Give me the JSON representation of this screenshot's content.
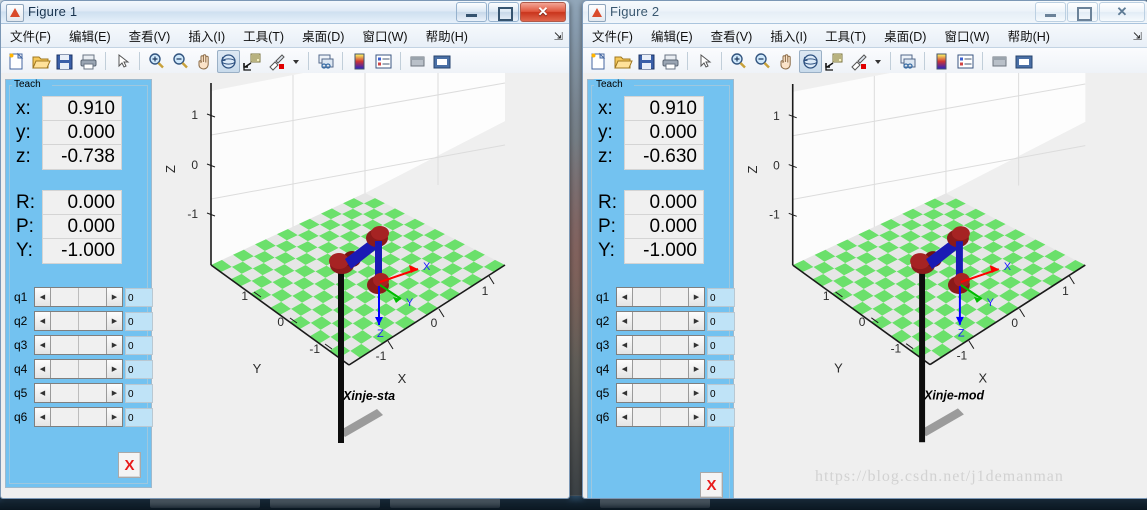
{
  "figures": [
    {
      "id": "figure-1",
      "title": "Figure 1",
      "active": true,
      "menu": [
        "文件(F)",
        "编辑(E)",
        "查看(V)",
        "插入(I)",
        "工具(T)",
        "桌面(D)",
        "窗口(W)",
        "帮助(H)"
      ],
      "menu_overflow": "⇲",
      "toolbar_icons": [
        "new-figure-icon",
        "open-file-icon",
        "save-figure-icon",
        "print-figure-icon",
        "separator",
        "edit-plot-icon",
        "separator",
        "zoom-in-icon",
        "zoom-out-icon",
        "pan-icon",
        "rotate-3d-icon",
        "data-cursor-icon",
        "brush-icon",
        "brush-dropdown-icon",
        "separator",
        "link-plot-icon",
        "separator",
        "colorbar-icon",
        "legend-icon",
        "separator",
        "hide-plot-tools-icon",
        "show-plot-tools-icon"
      ],
      "teach": {
        "legend": "Teach",
        "pose": [
          {
            "label": "x:",
            "value": "0.910"
          },
          {
            "label": "y:",
            "value": "0.000"
          },
          {
            "label": "z:",
            "value": "-0.738"
          }
        ],
        "orientation": [
          {
            "label": "R:",
            "value": "0.000"
          },
          {
            "label": "P:",
            "value": "0.000"
          },
          {
            "label": "Y:",
            "value": "-1.000"
          }
        ],
        "joints": [
          {
            "label": "q1",
            "value": "0"
          },
          {
            "label": "q2",
            "value": "0"
          },
          {
            "label": "q3",
            "value": "0"
          },
          {
            "label": "q4",
            "value": "0"
          },
          {
            "label": "q5",
            "value": "0"
          },
          {
            "label": "q6",
            "value": "0"
          }
        ],
        "close_label": "X"
      },
      "plot": {
        "robot_name": "Xinje-sta",
        "axis_labels": {
          "x": "X",
          "y": "Y",
          "z": "Z"
        },
        "triad": {
          "x": "X",
          "y": "Y",
          "z": "Z"
        },
        "ticks": {
          "x": [
            "-1",
            "0",
            "1"
          ],
          "y": [
            "-1",
            "0",
            "1"
          ],
          "z": [
            "-1",
            "0",
            "1"
          ]
        }
      }
    },
    {
      "id": "figure-2",
      "title": "Figure 2",
      "active": false,
      "menu": [
        "文件(F)",
        "编辑(E)",
        "查看(V)",
        "插入(I)",
        "工具(T)",
        "桌面(D)",
        "窗口(W)",
        "帮助(H)"
      ],
      "menu_overflow": "⇲",
      "toolbar_icons": [
        "new-figure-icon",
        "open-file-icon",
        "save-figure-icon",
        "print-figure-icon",
        "separator",
        "edit-plot-icon",
        "separator",
        "zoom-in-icon",
        "zoom-out-icon",
        "pan-icon",
        "rotate-3d-icon",
        "data-cursor-icon",
        "brush-icon",
        "brush-dropdown-icon",
        "separator",
        "link-plot-icon",
        "separator",
        "colorbar-icon",
        "legend-icon",
        "separator",
        "hide-plot-tools-icon",
        "show-plot-tools-icon"
      ],
      "teach": {
        "legend": "Teach",
        "pose": [
          {
            "label": "x:",
            "value": "0.910"
          },
          {
            "label": "y:",
            "value": "0.000"
          },
          {
            "label": "z:",
            "value": "-0.630"
          }
        ],
        "orientation": [
          {
            "label": "R:",
            "value": "0.000"
          },
          {
            "label": "P:",
            "value": "0.000"
          },
          {
            "label": "Y:",
            "value": "-1.000"
          }
        ],
        "joints": [
          {
            "label": "q1",
            "value": "0"
          },
          {
            "label": "q2",
            "value": "0"
          },
          {
            "label": "q3",
            "value": "0"
          },
          {
            "label": "q4",
            "value": "0"
          },
          {
            "label": "q5",
            "value": "0"
          },
          {
            "label": "q6",
            "value": "0"
          }
        ],
        "close_label": "X"
      },
      "plot": {
        "robot_name": "Xinje-mod",
        "axis_labels": {
          "x": "X",
          "y": "Y",
          "z": "Z"
        },
        "triad": {
          "x": "X",
          "y": "Y",
          "z": "Z"
        },
        "ticks": {
          "x": [
            "-1",
            "0",
            "1"
          ],
          "y": [
            "-1",
            "0",
            "1"
          ],
          "z": [
            "-1",
            "0",
            "1"
          ]
        }
      }
    }
  ],
  "watermark": "https://blog.csdn.net/j1demanman",
  "colors": {
    "teach_panel": "#73c2f0",
    "floor_tile": "#6be06b",
    "joint": "#8b1a1a",
    "link": "#1a1ab4",
    "axis_x": "#ff0000",
    "axis_y": "#00bb00",
    "axis_z": "#0000ff",
    "close_x": "#e81c1c"
  }
}
